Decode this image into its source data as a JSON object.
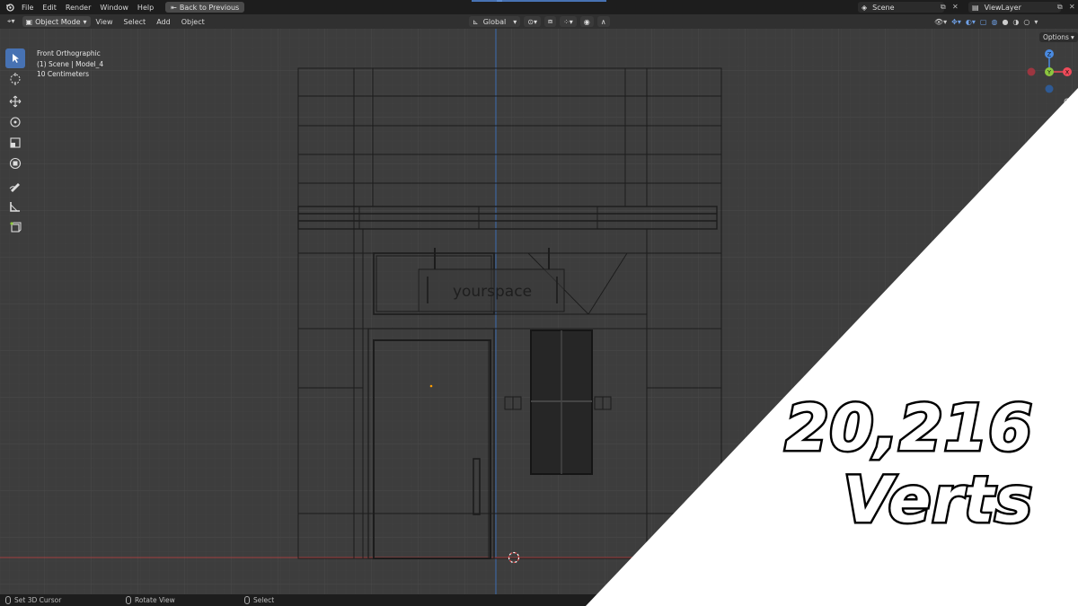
{
  "topbar": {
    "menu": [
      "File",
      "Edit",
      "Render",
      "Window",
      "Help"
    ],
    "back_label": "Back to Previous",
    "scene_label": "Scene",
    "view_layer_label": "ViewLayer"
  },
  "header": {
    "mode_label": "Object Mode",
    "menu": [
      "View",
      "Select",
      "Add",
      "Object"
    ],
    "orientation_label": "Global"
  },
  "viewport": {
    "view_name": "Front Orthographic",
    "collection_info": "(1) Scene | Model_4",
    "scale_info": "10 Centimeters",
    "options_label": "Options",
    "sign_text": "yourspace",
    "gizmo_axes": [
      "Z",
      "Y",
      "X"
    ]
  },
  "statusbar": {
    "items": [
      "Set 3D Cursor",
      "Rotate View",
      "Select"
    ]
  },
  "overlay": {
    "vert_count": "20,216",
    "vert_label": "Verts"
  },
  "colors": {
    "accent": "#4772b3",
    "x_axis": "#f04b5a",
    "y_axis": "#8cc63f",
    "z_axis": "#4a8ae0"
  }
}
